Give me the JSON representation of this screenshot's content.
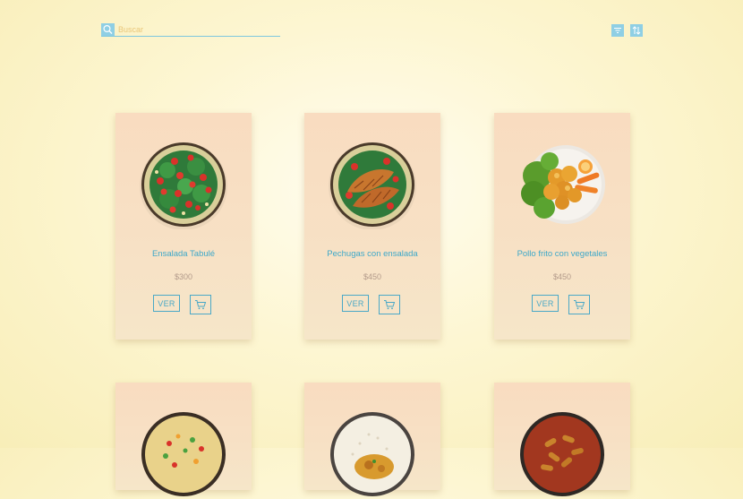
{
  "search": {
    "placeholder": "Buscar"
  },
  "toolbar": {
    "filter_icon": "filter-icon",
    "sort_icon": "sort-icon"
  },
  "products": [
    {
      "name": "Ensalada Tabulé",
      "price": "$300",
      "view_label": "VER",
      "dish": "salad"
    },
    {
      "name": "Pechugas con ensalada",
      "price": "$450",
      "view_label": "VER",
      "dish": "chicken-breast"
    },
    {
      "name": "Pollo frito con vegetales",
      "price": "$450",
      "view_label": "VER",
      "dish": "fried-chicken"
    },
    {
      "dish": "rice"
    },
    {
      "dish": "rice-curry"
    },
    {
      "dish": "pasta"
    }
  ],
  "colors": {
    "accent": "#4aa8c7",
    "card": "#f8dfc2",
    "price": "#b39a8a"
  }
}
